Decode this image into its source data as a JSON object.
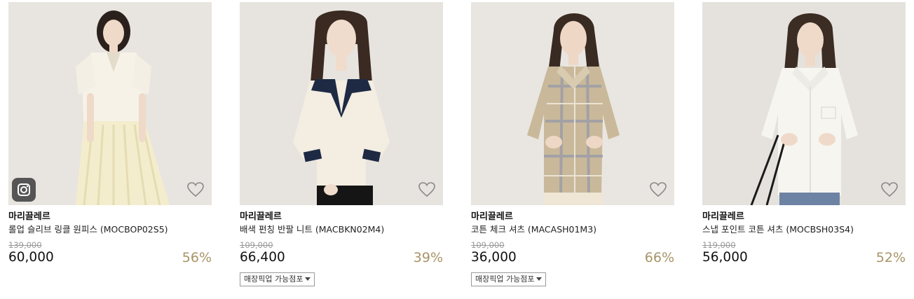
{
  "products": [
    {
      "brand": "마리끌레르",
      "name": "롤업 슬리브 링클 원피스 (MOCBOP02S5)",
      "original_price": "139,000",
      "price": "60,000",
      "discount": "56%",
      "pickup_label": "",
      "has_instagram": true,
      "icon": "heart-outline-icon"
    },
    {
      "brand": "마리끌레르",
      "name": "배색 펀칭 반팔 니트 (MACBKN02M4)",
      "original_price": "109,000",
      "price": "66,400",
      "discount": "39%",
      "pickup_label": "매장픽업 가능점포",
      "has_instagram": false,
      "icon": "heart-outline-icon"
    },
    {
      "brand": "마리끌레르",
      "name": "코튼 체크 셔츠 (MACASH01M3)",
      "original_price": "109,000",
      "price": "36,000",
      "discount": "66%",
      "pickup_label": "매장픽업 가능점포",
      "has_instagram": false,
      "icon": "heart-outline-icon"
    },
    {
      "brand": "마리끌레르",
      "name": "스냅 포인트 코튼 셔츠 (MOCBSH03S4)",
      "original_price": "119,000",
      "price": "56,000",
      "discount": "52%",
      "pickup_label": "",
      "has_instagram": false,
      "icon": "heart-outline-icon"
    }
  ],
  "colors": {
    "discount": "#a89466",
    "original_price": "#999999",
    "photo_background": "#e6e3de"
  }
}
